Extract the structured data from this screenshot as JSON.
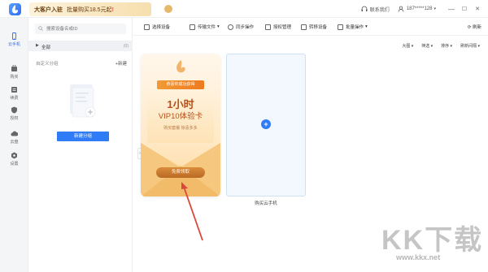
{
  "titlebar": {
    "promo_lead": "大客户入驻",
    "promo_text": "批量购买18.5元起",
    "promo_accent": "!",
    "contact_label": "联系我们",
    "account": "187*****128",
    "minimize": "—",
    "maximize": "☐",
    "close": "✕"
  },
  "rail": {
    "items": [
      {
        "label": "云手机",
        "icon": "phone-icon"
      },
      {
        "label": "购买",
        "icon": "cart-icon"
      },
      {
        "label": "续费",
        "icon": "renew-icon"
      },
      {
        "label": "授权",
        "icon": "authorize-icon"
      },
      {
        "label": "云盘",
        "icon": "cloud-icon"
      },
      {
        "label": "设置",
        "icon": "settings-icon"
      }
    ]
  },
  "panel": {
    "search_placeholder": "搜索设备名或ID",
    "all_label": "全部",
    "all_count": "(0)",
    "group_title": "自定义分组",
    "new_group": "+新建",
    "create_group_button": "新建分组"
  },
  "toolbar": {
    "select_device": "选择设备",
    "upload_file": "传输文件",
    "sync_op": "同步操作",
    "auth_manage": "授权管理",
    "transfer_device": "转移设备",
    "batch_op": "批量操作",
    "refresh": "刷新"
  },
  "viewbar": {
    "big_view": "大图",
    "filter": "筛选",
    "sort": "排序",
    "refresh_interval": "刷新间隔"
  },
  "promo_card": {
    "ribbon": "恭喜你成功获得",
    "headline": "1小时",
    "subheadline": "VIP10体验卡",
    "note": "购买套餐 惊喜多多",
    "claim_button": "免费领取"
  },
  "buy_slot": {
    "plus": "+",
    "label": "购买云手机"
  },
  "watermark": {
    "text": "KK下载",
    "url": "www.kkx.net"
  },
  "colors": {
    "primary": "#2f7cf6",
    "promo_orange": "#ee7a1f",
    "arrow_red": "#d9493b"
  }
}
